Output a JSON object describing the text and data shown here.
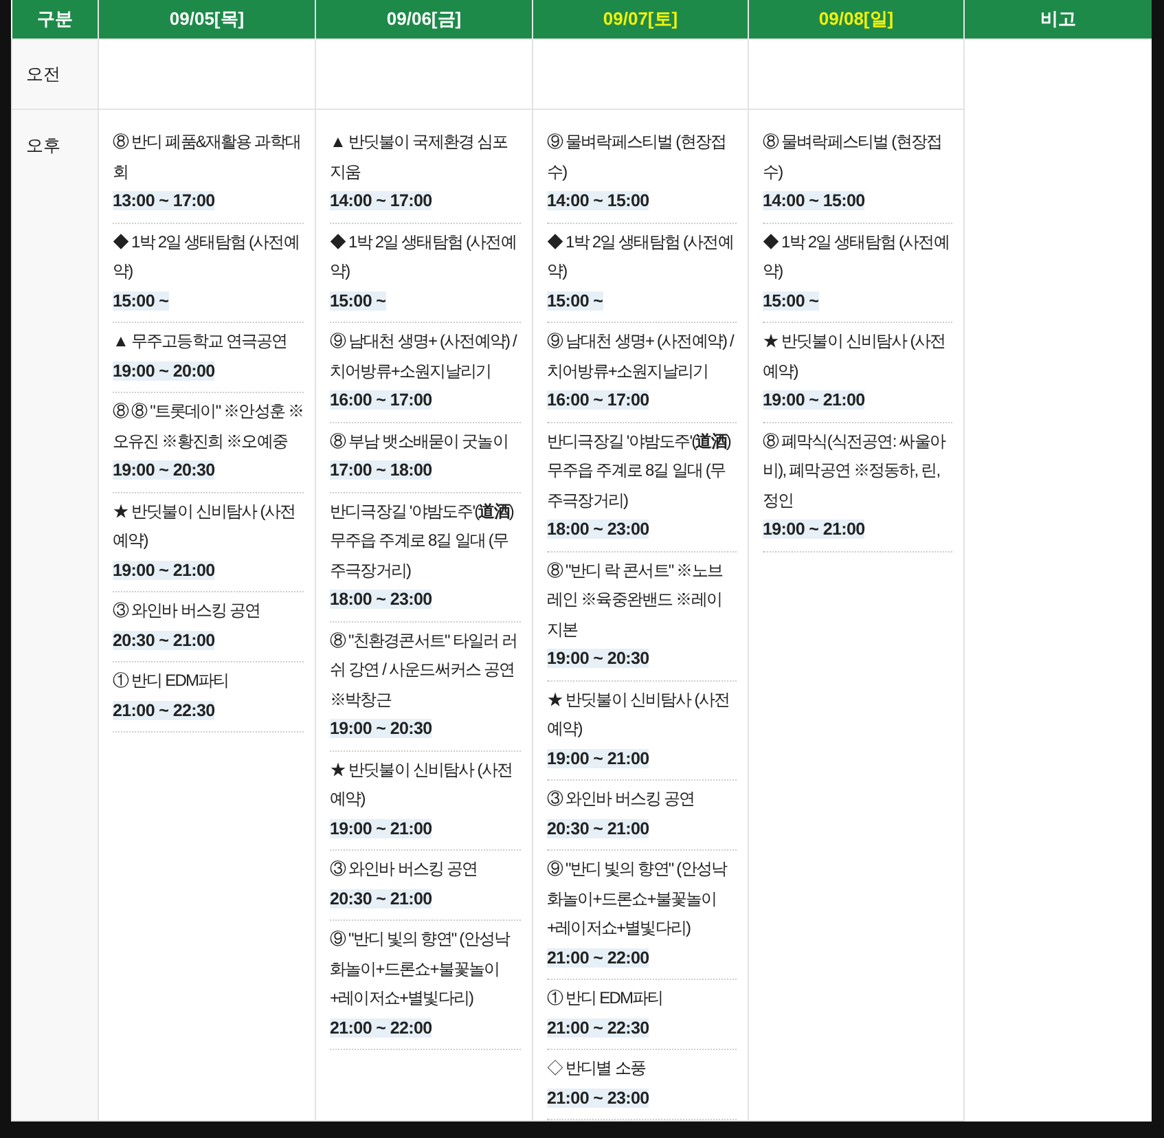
{
  "table": {
    "columns": [
      {
        "label": "구분",
        "weekend": false
      },
      {
        "label": "09/05[목]",
        "weekend": false
      },
      {
        "label": "09/06[금]",
        "weekend": false
      },
      {
        "label": "09/07[토]",
        "weekend": true
      },
      {
        "label": "09/08[일]",
        "weekend": true
      },
      {
        "label": "비고",
        "weekend": false
      }
    ],
    "rows": [
      {
        "label": "오전"
      },
      {
        "label": "오후",
        "cells": [
          [
            {
              "title": "⑧ 반디 폐품&재활용 과학대회",
              "time": "13:00 ~ 17:00"
            },
            {
              "title": "◆ 1박 2일 생태탐험 (사전예약)",
              "time": "15:00 ~"
            },
            {
              "title": "▲ 무주고등학교 연극공연",
              "time": "19:00 ~ 20:00"
            },
            {
              "title": "⑧ ⑧ \"트롯데이\" ※안성훈 ※오유진 ※황진희 ※오예중",
              "time": "19:00 ~ 20:30"
            },
            {
              "title": "★ 반딧불이 신비탐사 (사전예약)",
              "time": "19:00 ~ 21:00"
            },
            {
              "title": "③ 와인바 버스킹 공연",
              "time": "20:30 ~ 21:00"
            },
            {
              "title": "① 반디 EDM파티",
              "time": "21:00 ~ 22:30"
            }
          ],
          [
            {
              "title": "▲ 반딧불이 국제환경 심포지움",
              "time": "14:00 ~ 17:00"
            },
            {
              "title": "◆ 1박 2일 생태탐험 (사전예약)",
              "time": "15:00 ~"
            },
            {
              "title": "⑨ 남대천 생명+ (사전예약) / 치어방류+소원지날리기",
              "time": "16:00 ~ 17:00"
            },
            {
              "title": "⑧ 부남 뱃소배묻이 굿놀이",
              "time": "17:00 ~ 18:00"
            },
            {
              "title": "반디극장길 '야밤도주'(**道酒**) 무주읍 주계로 8길 일대 (무주극장거리)",
              "time": "18:00 ~ 23:00"
            },
            {
              "title": "⑧ \"친환경콘서트\" 타일러 러쉬 강연 / 사운드써커스 공연 ※박창근",
              "time": "19:00 ~ 20:30"
            },
            {
              "title": "★ 반딧불이 신비탐사 (사전예약)",
              "time": "19:00 ~ 21:00"
            },
            {
              "title": "③ 와인바 버스킹 공연",
              "time": "20:30 ~ 21:00"
            },
            {
              "title": "⑨ \"반디 빛의 향연\" (안성낙화놀이+드론쇼+불꽃놀이+레이저쇼+별빛다리)",
              "time": "21:00 ~ 22:00"
            }
          ],
          [
            {
              "title": "⑨ 물벼락페스티벌 (현장접수)",
              "time": "14:00 ~ 15:00"
            },
            {
              "title": "◆ 1박 2일 생태탐험 (사전예약)",
              "time": "15:00 ~"
            },
            {
              "title": "⑨ 남대천 생명+ (사전예약) / 치어방류+소원지날리기",
              "time": "16:00 ~ 17:00"
            },
            {
              "title": "반디극장길 '야밤도주'(**道酒**) 무주읍 주계로 8길 일대 (무주극장거리)",
              "time": "18:00 ~ 23:00"
            },
            {
              "title": "⑧ \"반디 락 콘서트\" ※노브레인 ※육중완밴드 ※레이지본",
              "time": "19:00 ~ 20:30"
            },
            {
              "title": "★ 반딧불이 신비탐사 (사전예약)",
              "time": "19:00 ~ 21:00"
            },
            {
              "title": "③ 와인바 버스킹 공연",
              "time": "20:30 ~ 21:00"
            },
            {
              "title": "⑨ \"반디 빛의 향연\" (안성낙화놀이+드론쇼+불꽃놀이+레이저쇼+별빛다리)",
              "time": "21:00 ~ 22:00"
            },
            {
              "title": "① 반디 EDM파티",
              "time": "21:00 ~ 22:30"
            },
            {
              "title": "◇ 반디별 소풍",
              "time": "21:00 ~ 23:00"
            }
          ],
          [
            {
              "title": "⑧ 물벼락페스티벌 (현장접수)",
              "time": "14:00 ~ 15:00"
            },
            {
              "title": "◆ 1박 2일 생태탐험 (사전예약)",
              "time": "15:00 ~"
            },
            {
              "title": "★ 반딧불이 신비탐사 (사전예약)",
              "time": "19:00 ~ 21:00"
            },
            {
              "title": "⑧ 폐막식(식전공연: 싸울아비), 폐막공연 ※정동하, 린, 정인",
              "time": "19:00 ~ 21:00"
            }
          ]
        ]
      }
    ]
  }
}
